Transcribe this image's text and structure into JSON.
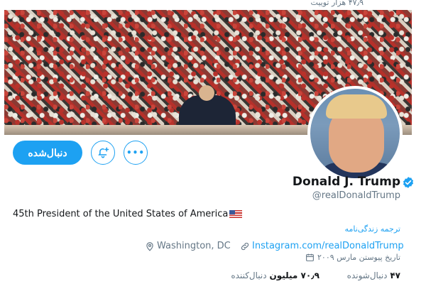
{
  "header": {
    "tweet_count": "۴۷٫۹ هزار توییت"
  },
  "profile": {
    "name": "Donald J. Trump",
    "handle": "@realDonaldTrump",
    "bio": "45th President of the United States of America",
    "translate_bio": "ترجمه زندگی‌نامه",
    "location": "Washington, DC",
    "website": "Instagram.com/realDonaldTrump",
    "joined": "تاریخ پیوستن مارس ۲۰۰۹",
    "verified": true
  },
  "actions": {
    "follow_label": "دنبال‌شده",
    "more_label": "•••"
  },
  "stats": {
    "following_count": "۴۷",
    "following_label": "دنبال‌شونده",
    "followers_count": "۷۰٫۹ میلیون",
    "followers_label": "دنبال‌کننده"
  },
  "colors": {
    "accent": "#1da1f2",
    "text": "#14171a",
    "muted": "#657786"
  }
}
